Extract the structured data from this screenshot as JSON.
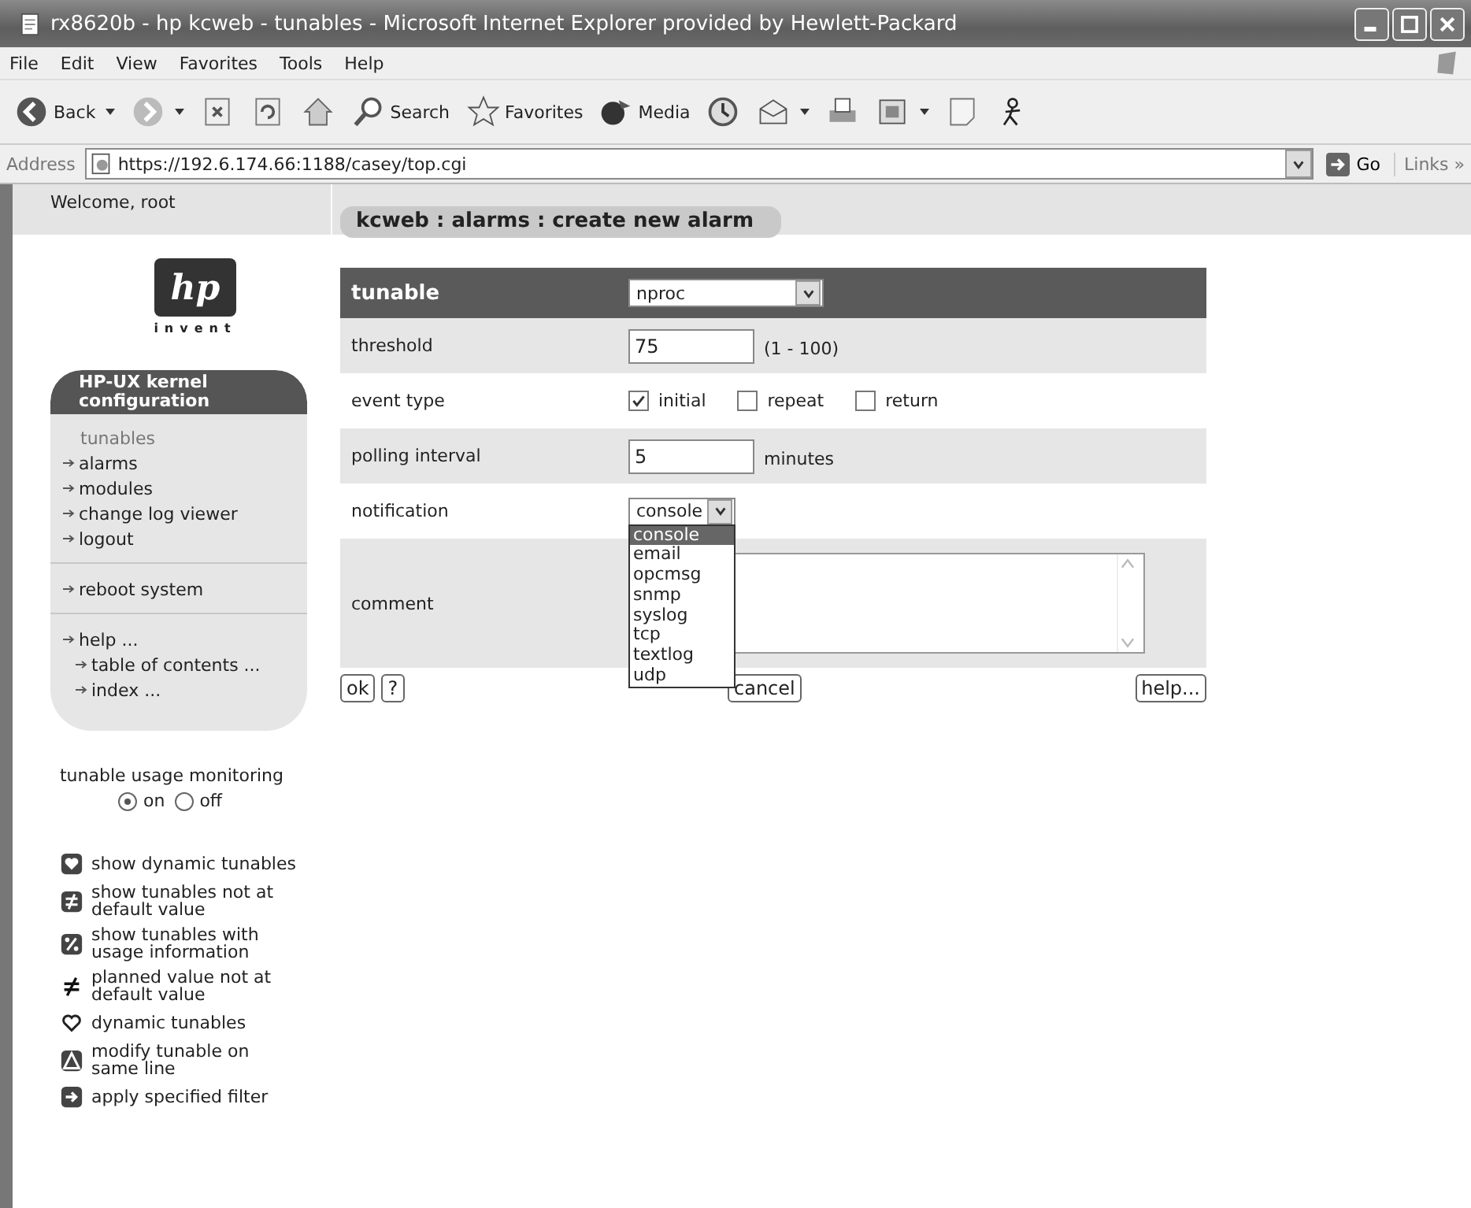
{
  "window": {
    "title": "rx8620b - hp kcweb - tunables - Microsoft Internet Explorer provided by Hewlett-Packard"
  },
  "menu": [
    "File",
    "Edit",
    "View",
    "Favorites",
    "Tools",
    "Help"
  ],
  "toolbar": [
    {
      "kind": "back",
      "label": "Back",
      "dropdown": true
    },
    {
      "kind": "forward",
      "dropdown": true
    },
    {
      "kind": "stop"
    },
    {
      "kind": "refresh"
    },
    {
      "kind": "home"
    },
    {
      "kind": "search",
      "label": "Search"
    },
    {
      "kind": "favorites",
      "label": "Favorites"
    },
    {
      "kind": "media",
      "label": "Media"
    },
    {
      "kind": "history"
    },
    {
      "kind": "mail",
      "dropdown": true
    },
    {
      "kind": "print"
    },
    {
      "kind": "edit",
      "dropdown": true
    },
    {
      "kind": "note"
    },
    {
      "kind": "messenger"
    }
  ],
  "address": {
    "label": "Address",
    "url": "https://192.6.174.66:1188/casey/top.cgi",
    "go": "Go",
    "links": "Links »"
  },
  "sidebar": {
    "welcome": "Welcome, root",
    "logo": {
      "mark": "hp",
      "tagline": "invent"
    },
    "panel": {
      "title": "HP-UX kernel configuration",
      "groups": [
        [
          {
            "label": "tunables",
            "current": true
          },
          {
            "label": "alarms",
            "current": false
          },
          {
            "label": "modules",
            "current": false
          },
          {
            "label": "change log viewer",
            "current": false
          },
          {
            "label": "logout",
            "current": false
          }
        ],
        [
          {
            "label": "reboot system",
            "current": false
          }
        ],
        [
          {
            "label": "help ...",
            "current": false,
            "children": [
              {
                "label": "table of contents ...",
                "current": false
              },
              {
                "label": "index ...",
                "current": false
              }
            ]
          }
        ]
      ]
    },
    "monitoring": {
      "label": "tunable usage monitoring",
      "options": [
        {
          "label": "on",
          "selected": true
        },
        {
          "label": "off",
          "selected": false
        }
      ]
    },
    "legend": [
      {
        "kind": "dynamic",
        "text": "show dynamic tunables"
      },
      {
        "kind": "not-default",
        "text": "show tunables not at default value"
      },
      {
        "kind": "usage",
        "text": "show tunables with usage information"
      },
      {
        "kind": "planned",
        "text": "planned value not at default value"
      },
      {
        "kind": "dynamic-plain",
        "text": "dynamic tunables"
      },
      {
        "kind": "modify",
        "text": "modify tunable on same line"
      },
      {
        "kind": "apply",
        "text": "apply specified filter"
      }
    ]
  },
  "form": {
    "breadcrumb": "kcweb : alarms : create new alarm",
    "rows": [
      {
        "kind": "header-select",
        "label": "tunable",
        "value": "nproc"
      },
      {
        "kind": "text",
        "label": "threshold",
        "value": "75",
        "note": "(1 - 100)"
      },
      {
        "kind": "checkboxes",
        "label": "event type",
        "options": [
          {
            "label": "initial",
            "checked": true
          },
          {
            "label": "repeat",
            "checked": false
          },
          {
            "label": "return",
            "checked": false
          }
        ]
      },
      {
        "kind": "text",
        "label": "polling interval",
        "value": "5",
        "note": "minutes"
      },
      {
        "kind": "select",
        "label": "notification",
        "value": "console",
        "open": true,
        "options": [
          {
            "label": "console",
            "selected": true
          },
          {
            "label": "email",
            "selected": false
          },
          {
            "label": "opcmsg",
            "selected": false
          },
          {
            "label": "snmp",
            "selected": false
          },
          {
            "label": "syslog",
            "selected": false
          },
          {
            "label": "tcp",
            "selected": false
          },
          {
            "label": "textlog",
            "selected": false
          },
          {
            "label": "udp",
            "selected": false
          }
        ]
      },
      {
        "kind": "textarea",
        "label": "comment"
      }
    ],
    "buttons": [
      {
        "kind": "left",
        "label": "ok"
      },
      {
        "kind": "left",
        "label": "?"
      },
      {
        "kind": "middle",
        "label": "cancel"
      },
      {
        "kind": "right",
        "label": "help..."
      }
    ]
  }
}
